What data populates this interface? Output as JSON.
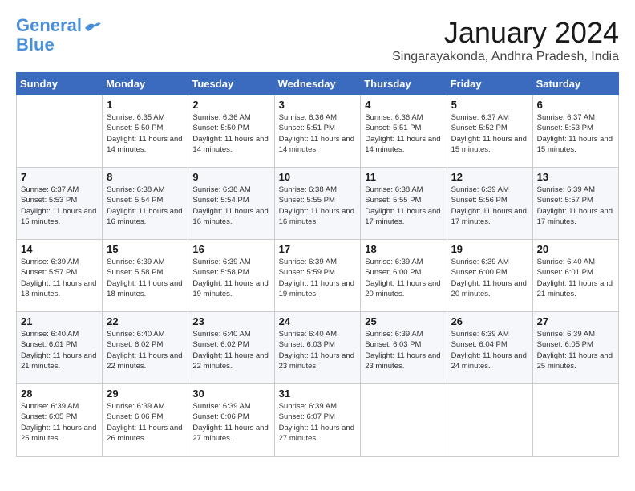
{
  "header": {
    "logo_line1": "General",
    "logo_line2": "Blue",
    "month": "January 2024",
    "location": "Singarayakonda, Andhra Pradesh, India"
  },
  "weekdays": [
    "Sunday",
    "Monday",
    "Tuesday",
    "Wednesday",
    "Thursday",
    "Friday",
    "Saturday"
  ],
  "weeks": [
    [
      {
        "day": "",
        "sunrise": "",
        "sunset": "",
        "daylight": ""
      },
      {
        "day": "1",
        "sunrise": "Sunrise: 6:35 AM",
        "sunset": "Sunset: 5:50 PM",
        "daylight": "Daylight: 11 hours and 14 minutes."
      },
      {
        "day": "2",
        "sunrise": "Sunrise: 6:36 AM",
        "sunset": "Sunset: 5:50 PM",
        "daylight": "Daylight: 11 hours and 14 minutes."
      },
      {
        "day": "3",
        "sunrise": "Sunrise: 6:36 AM",
        "sunset": "Sunset: 5:51 PM",
        "daylight": "Daylight: 11 hours and 14 minutes."
      },
      {
        "day": "4",
        "sunrise": "Sunrise: 6:36 AM",
        "sunset": "Sunset: 5:51 PM",
        "daylight": "Daylight: 11 hours and 14 minutes."
      },
      {
        "day": "5",
        "sunrise": "Sunrise: 6:37 AM",
        "sunset": "Sunset: 5:52 PM",
        "daylight": "Daylight: 11 hours and 15 minutes."
      },
      {
        "day": "6",
        "sunrise": "Sunrise: 6:37 AM",
        "sunset": "Sunset: 5:53 PM",
        "daylight": "Daylight: 11 hours and 15 minutes."
      }
    ],
    [
      {
        "day": "7",
        "sunrise": "Sunrise: 6:37 AM",
        "sunset": "Sunset: 5:53 PM",
        "daylight": "Daylight: 11 hours and 15 minutes."
      },
      {
        "day": "8",
        "sunrise": "Sunrise: 6:38 AM",
        "sunset": "Sunset: 5:54 PM",
        "daylight": "Daylight: 11 hours and 16 minutes."
      },
      {
        "day": "9",
        "sunrise": "Sunrise: 6:38 AM",
        "sunset": "Sunset: 5:54 PM",
        "daylight": "Daylight: 11 hours and 16 minutes."
      },
      {
        "day": "10",
        "sunrise": "Sunrise: 6:38 AM",
        "sunset": "Sunset: 5:55 PM",
        "daylight": "Daylight: 11 hours and 16 minutes."
      },
      {
        "day": "11",
        "sunrise": "Sunrise: 6:38 AM",
        "sunset": "Sunset: 5:55 PM",
        "daylight": "Daylight: 11 hours and 17 minutes."
      },
      {
        "day": "12",
        "sunrise": "Sunrise: 6:39 AM",
        "sunset": "Sunset: 5:56 PM",
        "daylight": "Daylight: 11 hours and 17 minutes."
      },
      {
        "day": "13",
        "sunrise": "Sunrise: 6:39 AM",
        "sunset": "Sunset: 5:57 PM",
        "daylight": "Daylight: 11 hours and 17 minutes."
      }
    ],
    [
      {
        "day": "14",
        "sunrise": "Sunrise: 6:39 AM",
        "sunset": "Sunset: 5:57 PM",
        "daylight": "Daylight: 11 hours and 18 minutes."
      },
      {
        "day": "15",
        "sunrise": "Sunrise: 6:39 AM",
        "sunset": "Sunset: 5:58 PM",
        "daylight": "Daylight: 11 hours and 18 minutes."
      },
      {
        "day": "16",
        "sunrise": "Sunrise: 6:39 AM",
        "sunset": "Sunset: 5:58 PM",
        "daylight": "Daylight: 11 hours and 19 minutes."
      },
      {
        "day": "17",
        "sunrise": "Sunrise: 6:39 AM",
        "sunset": "Sunset: 5:59 PM",
        "daylight": "Daylight: 11 hours and 19 minutes."
      },
      {
        "day": "18",
        "sunrise": "Sunrise: 6:39 AM",
        "sunset": "Sunset: 6:00 PM",
        "daylight": "Daylight: 11 hours and 20 minutes."
      },
      {
        "day": "19",
        "sunrise": "Sunrise: 6:39 AM",
        "sunset": "Sunset: 6:00 PM",
        "daylight": "Daylight: 11 hours and 20 minutes."
      },
      {
        "day": "20",
        "sunrise": "Sunrise: 6:40 AM",
        "sunset": "Sunset: 6:01 PM",
        "daylight": "Daylight: 11 hours and 21 minutes."
      }
    ],
    [
      {
        "day": "21",
        "sunrise": "Sunrise: 6:40 AM",
        "sunset": "Sunset: 6:01 PM",
        "daylight": "Daylight: 11 hours and 21 minutes."
      },
      {
        "day": "22",
        "sunrise": "Sunrise: 6:40 AM",
        "sunset": "Sunset: 6:02 PM",
        "daylight": "Daylight: 11 hours and 22 minutes."
      },
      {
        "day": "23",
        "sunrise": "Sunrise: 6:40 AM",
        "sunset": "Sunset: 6:02 PM",
        "daylight": "Daylight: 11 hours and 22 minutes."
      },
      {
        "day": "24",
        "sunrise": "Sunrise: 6:40 AM",
        "sunset": "Sunset: 6:03 PM",
        "daylight": "Daylight: 11 hours and 23 minutes."
      },
      {
        "day": "25",
        "sunrise": "Sunrise: 6:39 AM",
        "sunset": "Sunset: 6:03 PM",
        "daylight": "Daylight: 11 hours and 23 minutes."
      },
      {
        "day": "26",
        "sunrise": "Sunrise: 6:39 AM",
        "sunset": "Sunset: 6:04 PM",
        "daylight": "Daylight: 11 hours and 24 minutes."
      },
      {
        "day": "27",
        "sunrise": "Sunrise: 6:39 AM",
        "sunset": "Sunset: 6:05 PM",
        "daylight": "Daylight: 11 hours and 25 minutes."
      }
    ],
    [
      {
        "day": "28",
        "sunrise": "Sunrise: 6:39 AM",
        "sunset": "Sunset: 6:05 PM",
        "daylight": "Daylight: 11 hours and 25 minutes."
      },
      {
        "day": "29",
        "sunrise": "Sunrise: 6:39 AM",
        "sunset": "Sunset: 6:06 PM",
        "daylight": "Daylight: 11 hours and 26 minutes."
      },
      {
        "day": "30",
        "sunrise": "Sunrise: 6:39 AM",
        "sunset": "Sunset: 6:06 PM",
        "daylight": "Daylight: 11 hours and 27 minutes."
      },
      {
        "day": "31",
        "sunrise": "Sunrise: 6:39 AM",
        "sunset": "Sunset: 6:07 PM",
        "daylight": "Daylight: 11 hours and 27 minutes."
      },
      {
        "day": "",
        "sunrise": "",
        "sunset": "",
        "daylight": ""
      },
      {
        "day": "",
        "sunrise": "",
        "sunset": "",
        "daylight": ""
      },
      {
        "day": "",
        "sunrise": "",
        "sunset": "",
        "daylight": ""
      }
    ]
  ]
}
